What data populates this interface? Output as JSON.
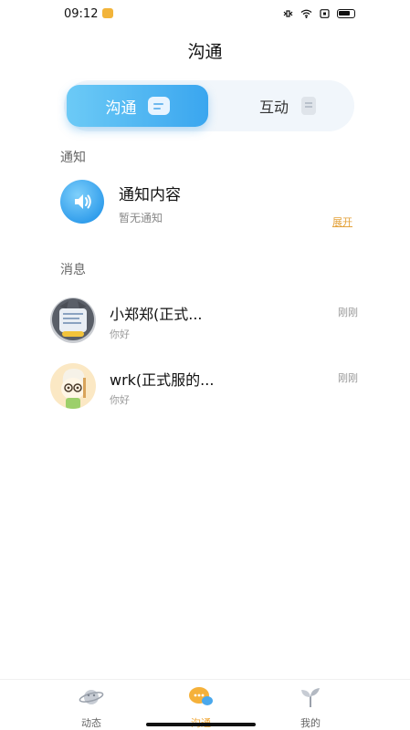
{
  "status_bar": {
    "time": "09:12"
  },
  "header": {
    "title": "沟通"
  },
  "tabs": [
    {
      "label": "沟通",
      "active": true
    },
    {
      "label": "互动",
      "active": false
    }
  ],
  "notifications": {
    "section_label": "通知",
    "title": "通知内容",
    "subtitle": "暂无通知",
    "expand_label": "展开"
  },
  "messages": {
    "section_label": "消息",
    "items": [
      {
        "name": "小郑郑(正式...",
        "preview": "你好",
        "time": "刚刚"
      },
      {
        "name": "wrk(正式服的...",
        "preview": "你好",
        "time": "刚刚"
      }
    ]
  },
  "bottom_nav": [
    {
      "label": "动态",
      "icon": "planet-icon",
      "active": false
    },
    {
      "label": "沟通",
      "icon": "chat-bubbles-icon",
      "active": true
    },
    {
      "label": "我的",
      "icon": "sprout-icon",
      "active": false
    }
  ],
  "colors": {
    "accent_blue": "#3aa6ef",
    "active_nav": "#f0a634",
    "expand_link": "#e3a23b"
  }
}
